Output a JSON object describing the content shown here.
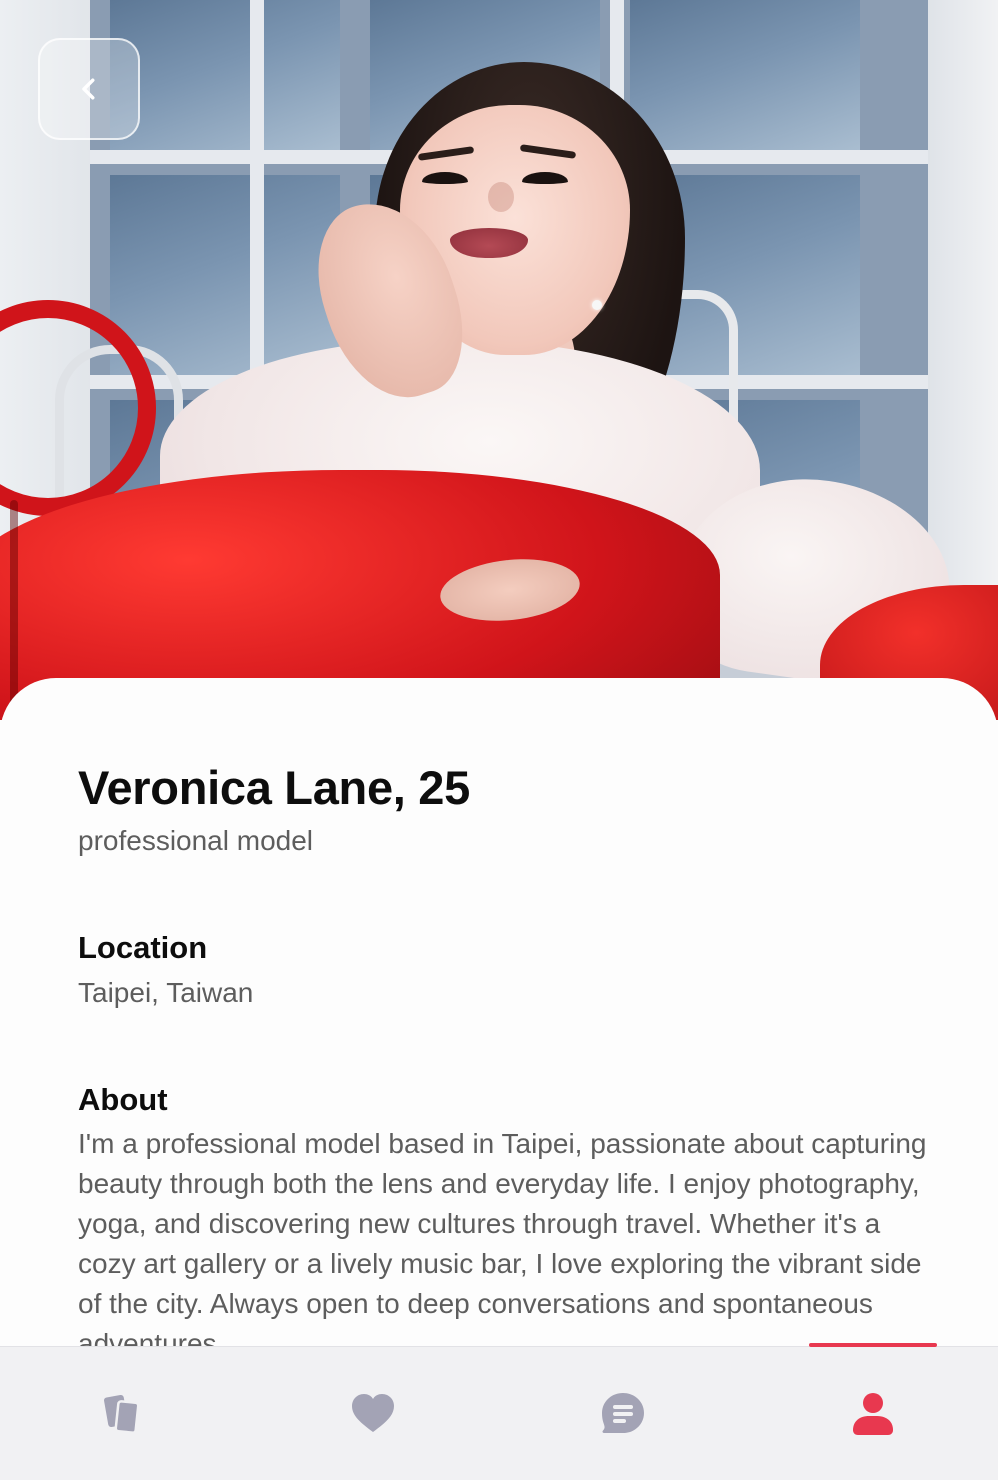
{
  "profile": {
    "name_age": "Veronica Lane, 25",
    "occupation": "professional model",
    "location_label": "Location",
    "location": "Taipei, Taiwan",
    "about_label": "About",
    "about": "I'm a professional model based in Taipei, passionate about capturing beauty through both the lens and everyday life. I enjoy photography, yoga, and discovering new cultures through travel. Whether it's a cozy art gallery or a lively music bar, I love exploring the vibrant side of the city. Always open to deep conversations and spontaneous adventures."
  },
  "header": {
    "back_icon": "chevron-left-icon"
  },
  "nav": {
    "items": [
      {
        "id": "cards",
        "icon": "cards-icon",
        "active": false
      },
      {
        "id": "likes",
        "icon": "heart-icon",
        "active": false
      },
      {
        "id": "messages",
        "icon": "chat-icon",
        "active": false
      },
      {
        "id": "profile",
        "icon": "person-icon",
        "active": true
      }
    ]
  },
  "colors": {
    "accent": "#e8384f",
    "inactive_icon": "#a3a3b5",
    "heading_text": "#0d0d0d",
    "body_text": "#5d5d5d"
  }
}
